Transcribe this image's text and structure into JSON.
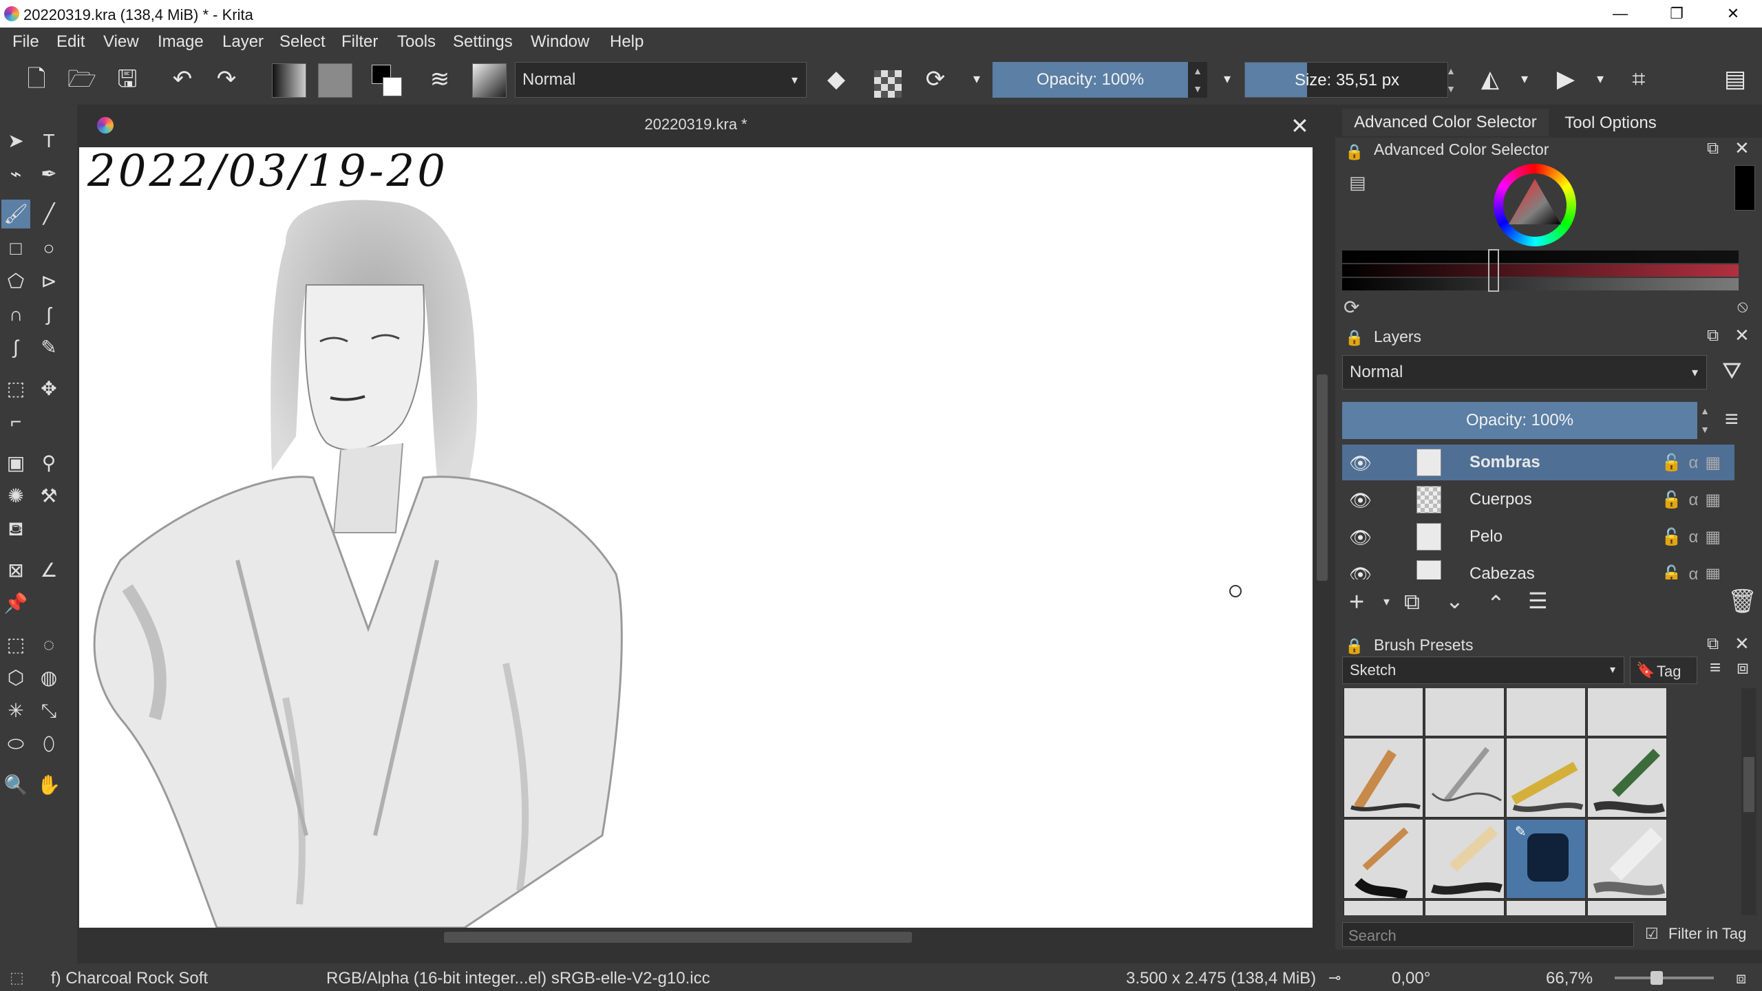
{
  "window": {
    "title": "20220319.kra (138,4 MiB)  * - Krita",
    "minimize": "—",
    "maximize": "❐",
    "close": "✕"
  },
  "menu": [
    "File",
    "Edit",
    "View",
    "Image",
    "Layer",
    "Select",
    "Filter",
    "Tools",
    "Settings",
    "Window",
    "Help"
  ],
  "toolbar": {
    "blend_mode": "Normal",
    "opacity": "Opacity: 100%",
    "size": "Size: 35,51 px"
  },
  "document": {
    "tab_title": "20220319.kra *",
    "handwritten_date": "2022/03/19-20"
  },
  "dockers": {
    "tabs": [
      "Advanced Color Selector",
      "Tool Options"
    ],
    "color_selector_title": "Advanced Color Selector",
    "layers_title": "Layers",
    "layers_blend": "Normal",
    "layers_opacity": "Opacity:  100%",
    "layers": [
      {
        "name": "Sombras",
        "selected": true
      },
      {
        "name": "Cuerpos",
        "selected": false
      },
      {
        "name": "Pelo",
        "selected": false
      },
      {
        "name": "Cabezas",
        "selected": false
      }
    ],
    "brush_presets_title": "Brush Presets",
    "brush_tag": "Sketch",
    "tag_label": "Tag",
    "search_placeholder": "Search",
    "filter_in_tag": "Filter in Tag"
  },
  "status": {
    "brush_name": "f) Charcoal Rock Soft",
    "color_space": "RGB/Alpha (16-bit integer...el)  sRGB-elle-V2-g10.icc",
    "dimensions": "3.500 x 2.475 (138,4 MiB)",
    "rotation": "0,00°",
    "zoom": "66,7%"
  },
  "colors": {
    "accent": "#5b7fa5",
    "selection": "#4f6f95",
    "panel": "#3a3a3a",
    "dark": "#323232"
  }
}
